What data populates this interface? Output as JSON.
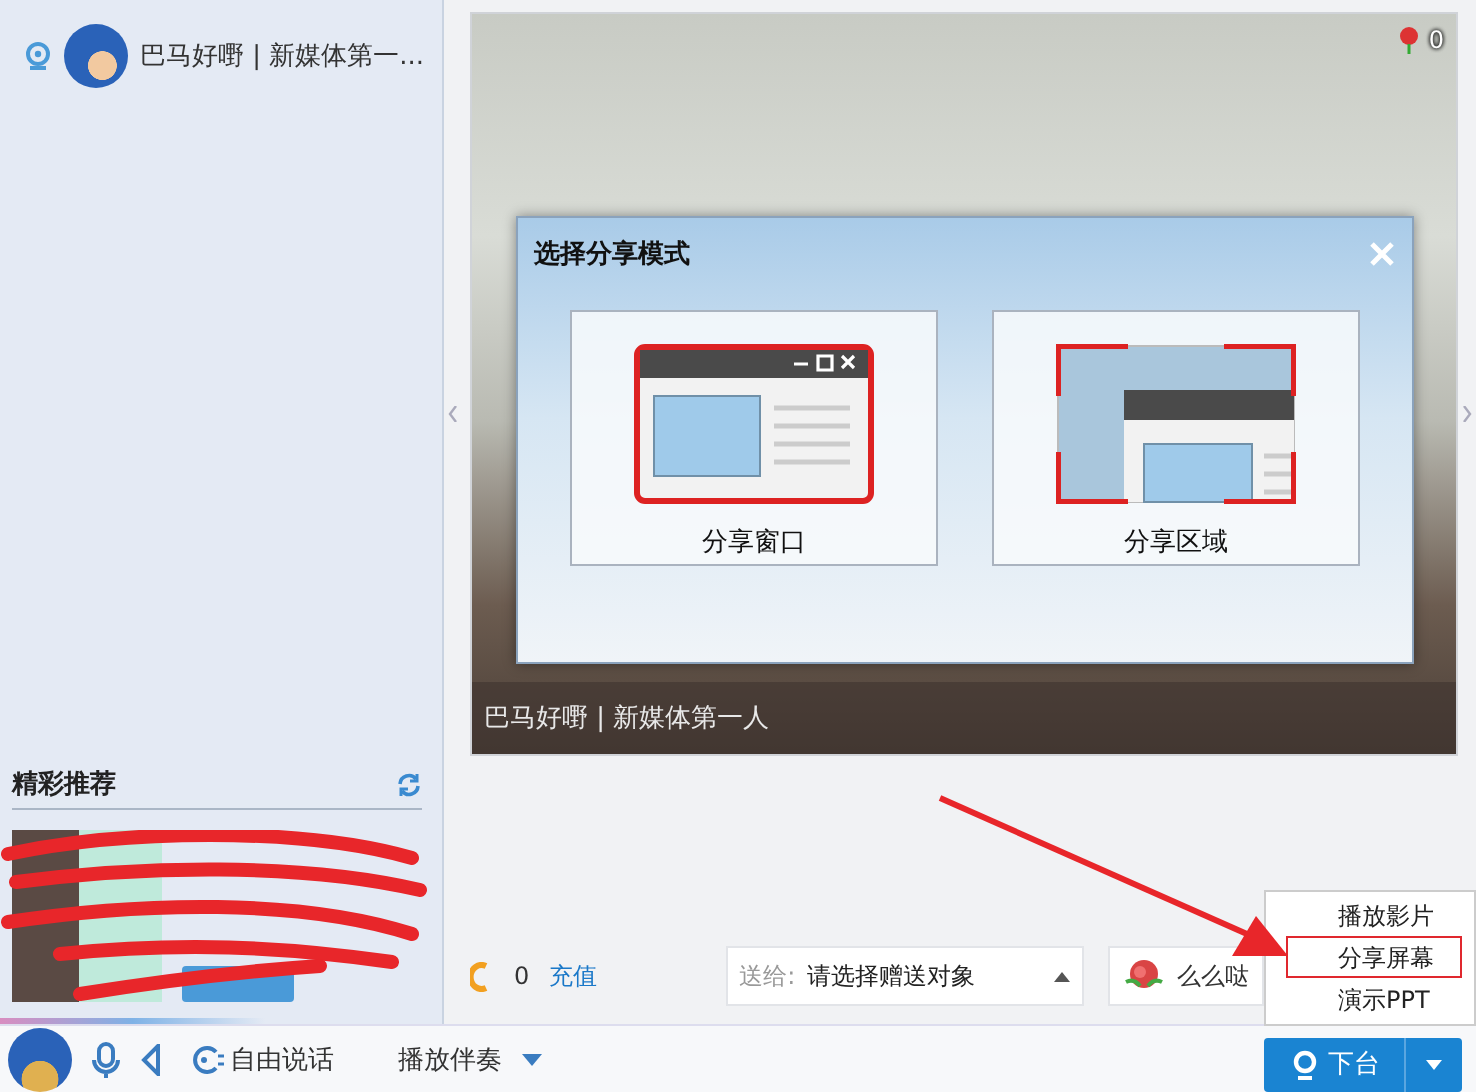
{
  "contact": {
    "name": "巴马好嘢 | 新媒体第一..."
  },
  "recommend": {
    "title": "精彩推荐"
  },
  "video": {
    "flower_count": "0",
    "caption": "巴马好嘢 | 新媒体第一人"
  },
  "dialog": {
    "title": "选择分享模式",
    "options": [
      {
        "kind": "window",
        "label": "分享窗口"
      },
      {
        "kind": "region",
        "label": "分享区域"
      }
    ]
  },
  "gift_bar": {
    "balance": "0",
    "recharge": "充值",
    "send_label": "送给:",
    "recipient": "请选择赠送对象",
    "gift": "么么哒"
  },
  "menu": {
    "items": [
      {
        "label": "播放影片",
        "selected": false
      },
      {
        "label": "分享屏幕",
        "selected": true
      },
      {
        "label": "演示PPT",
        "selected": false
      }
    ]
  },
  "toolbar": {
    "mode": "自由说话",
    "accompaniment": "播放伴奏",
    "action": "下台"
  }
}
